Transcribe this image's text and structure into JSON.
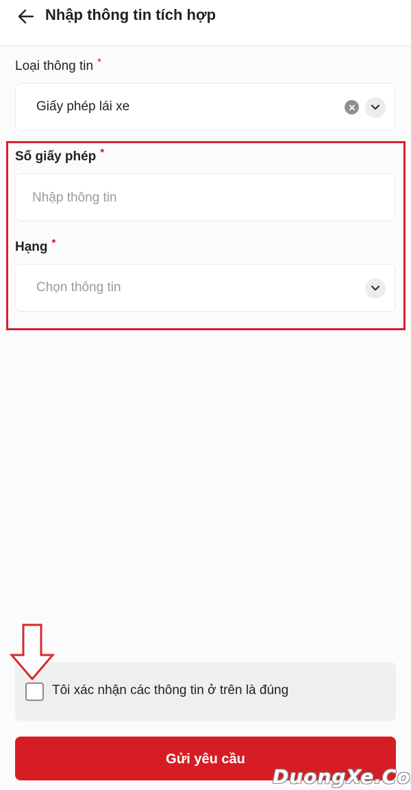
{
  "header": {
    "title": "Nhập thông tin tích hợp",
    "back_icon": "arrow-left-icon"
  },
  "form": {
    "info_type": {
      "label": "Loại thông tin",
      "required": "*",
      "value": "Giấy phép lái xe"
    },
    "license_number": {
      "label": "Số giấy phép",
      "required": "*",
      "placeholder": "Nhập thông tin",
      "value": ""
    },
    "license_class": {
      "label": "Hạng",
      "required": "*",
      "placeholder": "Chọn thông tin"
    }
  },
  "confirm": {
    "checked": false,
    "text": "Tôi xác nhận các thông tin ở trên là đúng"
  },
  "submit": {
    "label": "Gửi yêu cầu"
  },
  "watermark": {
    "text": "DuongXe.Com"
  },
  "colors": {
    "accent": "#d71d24",
    "highlight": "#cf2230",
    "required": "#c8102e"
  }
}
